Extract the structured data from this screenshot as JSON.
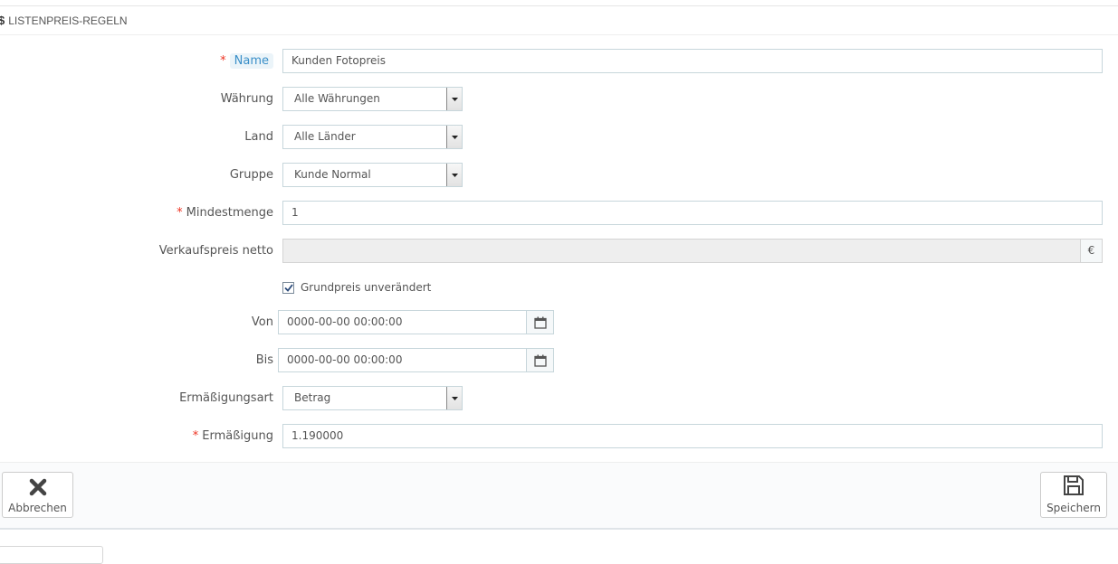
{
  "panel": {
    "title": "LISTENPREIS-REGELN",
    "icon": "dollar-icon"
  },
  "form": {
    "name": {
      "label": "Name",
      "required_mark": "*",
      "value": "Kunden Fotopreis"
    },
    "currency": {
      "label": "Währung",
      "value": "Alle Währungen"
    },
    "country": {
      "label": "Land",
      "value": "Alle Länder"
    },
    "group": {
      "label": "Gruppe",
      "value": "Kunde Normal"
    },
    "min_qty": {
      "label": "Mindestmenge",
      "required_mark": "*",
      "value": "1"
    },
    "net_price": {
      "label": "Verkaufspreis netto",
      "value": "",
      "addon": "€"
    },
    "keep_base_price": {
      "label": "Grundpreis unverändert",
      "checked": true
    },
    "from": {
      "label": "Von",
      "value": "0000-00-00 00:00:00",
      "icon": "calendar-icon"
    },
    "to": {
      "label": "Bis",
      "value": "0000-00-00 00:00:00",
      "icon": "calendar-icon"
    },
    "discount_type": {
      "label": "Ermäßigungsart",
      "value": "Betrag"
    },
    "discount": {
      "label": "Ermäßigung",
      "required_mark": "*",
      "value": "1.190000"
    }
  },
  "footer": {
    "cancel_label": "Abbrechen",
    "cancel_icon": "close-icon",
    "save_label": "Speichern",
    "save_icon": "save-icon"
  }
}
